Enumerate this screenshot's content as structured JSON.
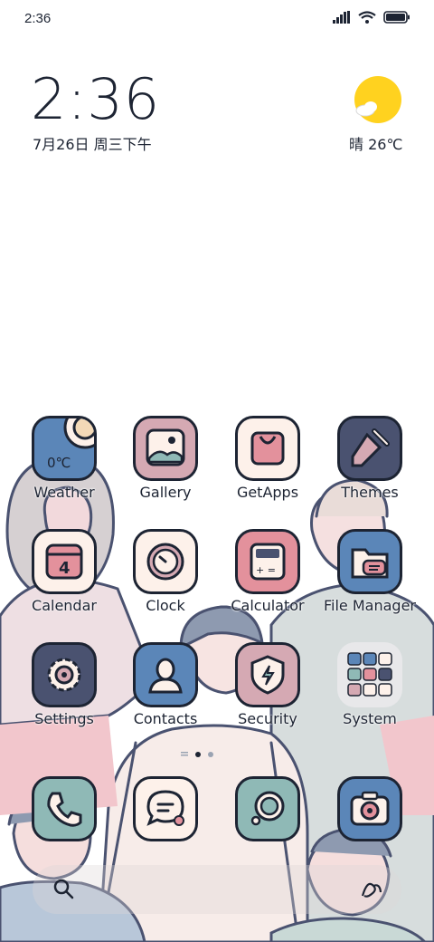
{
  "status_bar": {
    "time": "2:36",
    "icons": [
      "signal-icon",
      "wifi-icon",
      "battery-icon"
    ]
  },
  "clock_widget": {
    "time": "2:36",
    "date": "7月26日 周三下午"
  },
  "weather_widget": {
    "condition_temp": "晴 26℃",
    "icon": "sun-icon"
  },
  "apps": [
    {
      "label": "Weather",
      "icon": "weather-icon",
      "icon_text": "0℃",
      "color": "#5b86b8"
    },
    {
      "label": "Gallery",
      "icon": "gallery-icon",
      "color": "#d5a9b3"
    },
    {
      "label": "GetApps",
      "icon": "shopping-bag-icon",
      "color": "#fdf1ea"
    },
    {
      "label": "Themes",
      "icon": "paintbrush-icon",
      "color": "#4a5270"
    },
    {
      "label": "Calendar",
      "icon": "calendar-icon",
      "icon_text": "4",
      "color": "#fdf1ea"
    },
    {
      "label": "Clock",
      "icon": "clock-icon",
      "color": "#fdf1ea"
    },
    {
      "label": "Calculator",
      "icon": "calculator-icon",
      "color": "#e3919c"
    },
    {
      "label": "File Manager",
      "icon": "folder-icon",
      "color": "#5b86b8"
    },
    {
      "label": "Settings",
      "icon": "gear-icon",
      "color": "#4a5270"
    },
    {
      "label": "Contacts",
      "icon": "contacts-icon",
      "color": "#5b86b8"
    },
    {
      "label": "Security",
      "icon": "shield-icon",
      "color": "#d5a9b3"
    },
    {
      "label": "System",
      "icon": "folder-grid-icon",
      "color": "#e8e8ea"
    }
  ],
  "dock": [
    {
      "icon": "phone-icon",
      "color": "#8fb9b6"
    },
    {
      "icon": "messages-icon",
      "color": "#fdf1ea"
    },
    {
      "icon": "browser-icon",
      "color": "#8fb9b6"
    },
    {
      "icon": "camera-icon",
      "color": "#5b86b8"
    }
  ],
  "search": {
    "icon": "search-icon",
    "assistant_icon": "assistant-icon"
  }
}
